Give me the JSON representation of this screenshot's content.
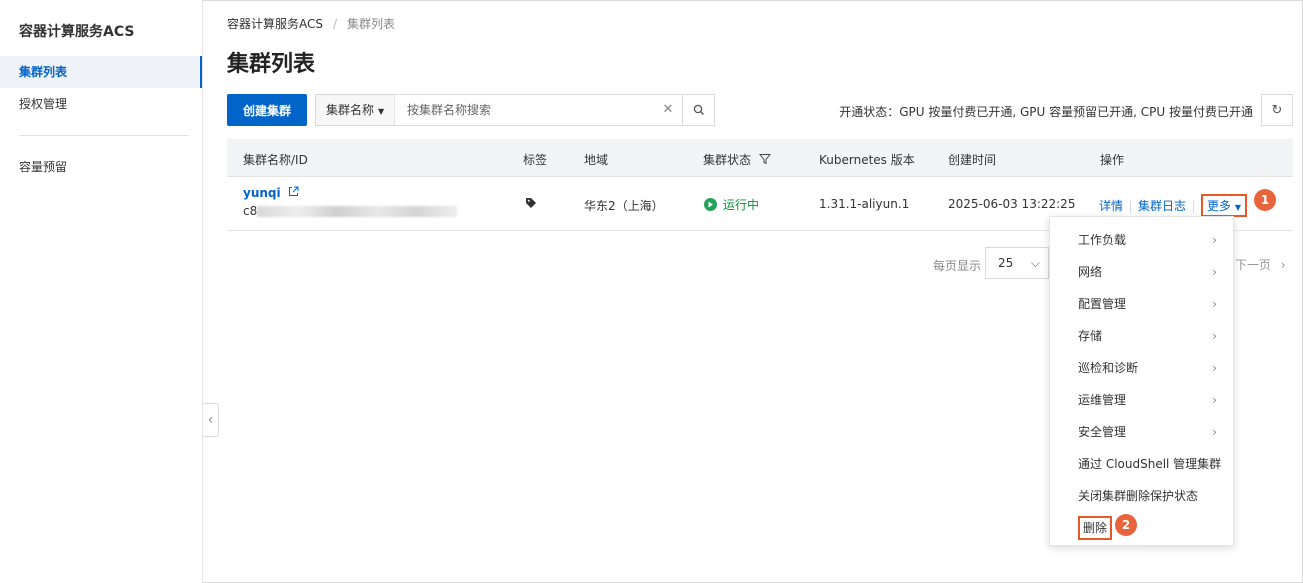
{
  "sidebar": {
    "title": "容器计算服务ACS",
    "items": [
      {
        "label": "集群列表"
      },
      {
        "label": "授权管理"
      },
      {
        "label": "容量预留"
      }
    ]
  },
  "breadcrumb": {
    "root": "容器计算服务ACS",
    "sep": "/",
    "current": "集群列表"
  },
  "page": {
    "title": "集群列表"
  },
  "toolbar": {
    "create_label": "创建集群",
    "search_field": "集群名称",
    "search_placeholder": "按集群名称搜索",
    "status_text": "开通状态：GPU 按量付费已开通, GPU 容量预留已开通, CPU 按量付费已开通"
  },
  "table": {
    "headers": [
      "集群名称/ID",
      "标签",
      "地域",
      "集群状态",
      "Kubernetes 版本",
      "创建时间",
      "操作"
    ],
    "rows": [
      {
        "name": "yunqi",
        "id_prefix": "c8",
        "region": "华东2（上海）",
        "status": "运行中",
        "version": "1.31.1-aliyun.1",
        "created": "2025-06-03 13:22:25",
        "actions": {
          "detail": "详情",
          "log": "集群日志",
          "more": "更多"
        }
      }
    ]
  },
  "pagination": {
    "per_page_label": "每页显示",
    "per_page": "25",
    "next_label": "下一页"
  },
  "menu": {
    "items": [
      {
        "label": "工作负载",
        "submenu": true
      },
      {
        "label": "网络",
        "submenu": true
      },
      {
        "label": "配置管理",
        "submenu": true
      },
      {
        "label": "存储",
        "submenu": true
      },
      {
        "label": "巡检和诊断",
        "submenu": true
      },
      {
        "label": "运维管理",
        "submenu": true
      },
      {
        "label": "安全管理",
        "submenu": true
      },
      {
        "label": "通过 CloudShell 管理集群",
        "submenu": false
      },
      {
        "label": "关闭集群删除保护状态",
        "submenu": false
      },
      {
        "label": "删除",
        "submenu": false
      }
    ]
  },
  "badges": [
    "1",
    "2"
  ],
  "colors": {
    "primary": "#0064c8",
    "running": "#23a35a",
    "highlight": "#e65a2a"
  }
}
